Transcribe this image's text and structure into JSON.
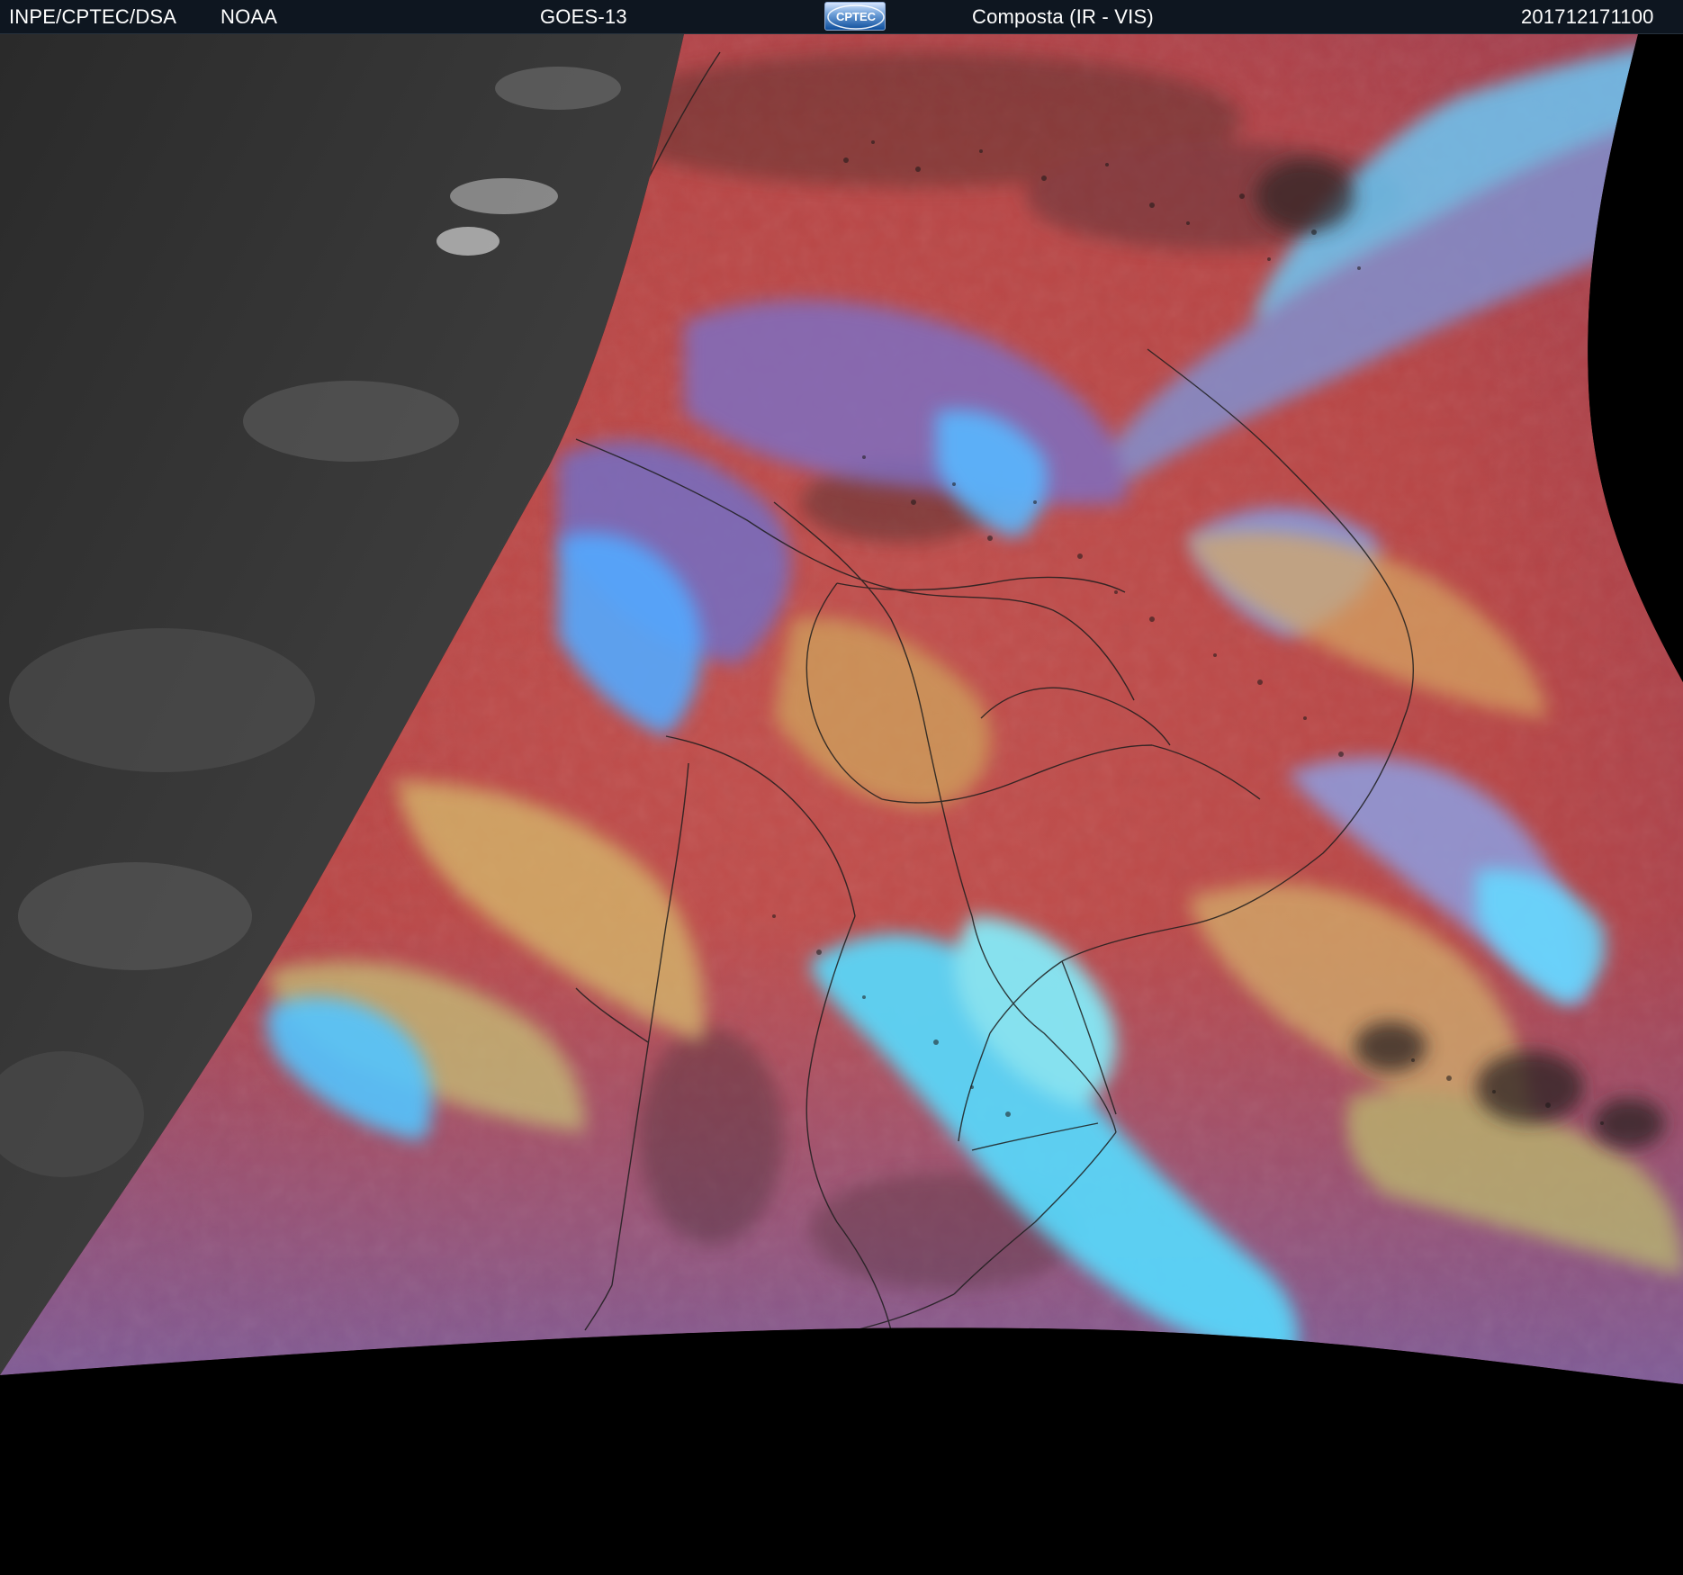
{
  "header": {
    "source_left": "INPE/CPTEC/DSA",
    "agency": "NOAA",
    "satellite": "GOES-13",
    "logo_text": "CPTEC",
    "product": "Composta (IR - VIS)",
    "timestamp": "201712171100"
  },
  "image": {
    "kind": "satellite composite image",
    "palette": {
      "background": "#000000",
      "header_bg": "#0e1620",
      "night_gray": "#3a3a3a",
      "land_red": "#b84444",
      "ocean_red": "#c7524d",
      "cloud_blue": "#4fd7ff",
      "cloud_yellow": "#c6bb63",
      "cloud_purple": "#8d6fcf"
    }
  }
}
